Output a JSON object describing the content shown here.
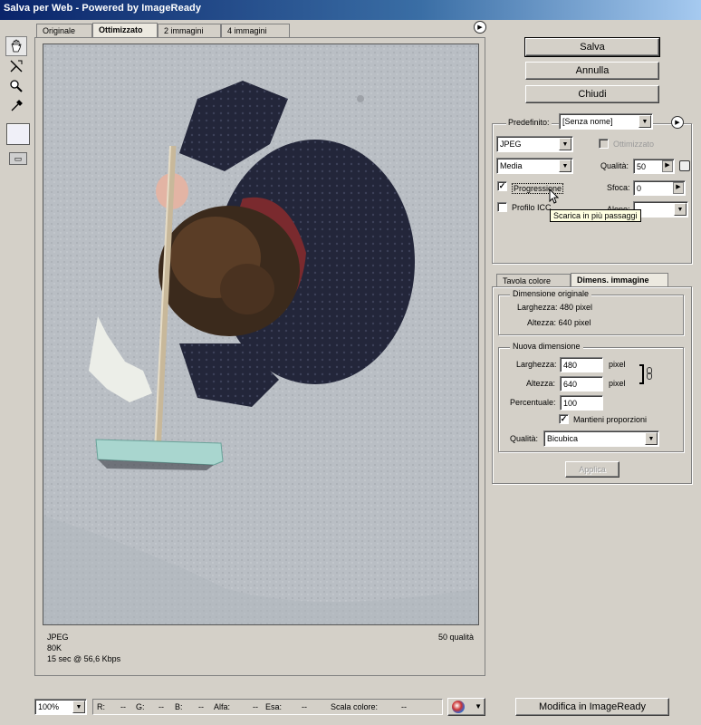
{
  "window": {
    "title": "Salva per Web - Powered by ImageReady"
  },
  "tabs": [
    "Originale",
    "Ottimizzato",
    "2 immagini",
    "4 immagini"
  ],
  "selected_tab": "Ottimizzato",
  "preview_info": {
    "format": "JPEG",
    "size": "80K",
    "time": "15 sec @ 56,6 Kbps",
    "quality": "50 qualità"
  },
  "buttons": {
    "save": "Salva",
    "cancel": "Annulla",
    "close": "Chiudi",
    "apply": "Applica",
    "edit_imageready": "Modifica in ImageReady"
  },
  "settings": {
    "preset_label": "Predefinito:",
    "preset_value": "[Senza nome]",
    "format": "JPEG",
    "quality_level": "Media",
    "optimized_label": "Ottimizzato",
    "optimized_checked": false,
    "quality_label": "Qualità:",
    "quality_value": "50",
    "progressive_label": "Progressione",
    "progressive_checked": true,
    "blur_label": "Sfoca:",
    "blur_value": "0",
    "icc_label": "Profilo ICC",
    "icc_checked": false,
    "matte_label": "Alone:",
    "tooltip": "Scarica in più passaggi"
  },
  "panel_tabs": [
    "Tavola colore",
    "Dimens. immagine"
  ],
  "selected_panel_tab": "Dimens. immagine",
  "original_size": {
    "legend": "Dimensione originale",
    "width": "Larghezza: 480 pixel",
    "height": "Altezza: 640 pixel"
  },
  "new_size": {
    "legend": "Nuova dimensione",
    "width_label": "Larghezza:",
    "width_value": "480",
    "height_label": "Altezza:",
    "height_value": "640",
    "unit": "pixel",
    "percent_label": "Percentuale:",
    "percent_value": "100",
    "constrain_label": "Mantieni proporzioni",
    "constrain_checked": true,
    "quality_label": "Qualità:",
    "quality_value": "Bicubica"
  },
  "statusbar": {
    "zoom": "100%",
    "r": "R:",
    "r_val": "--",
    "g": "G:",
    "g_val": "--",
    "b": "B:",
    "b_val": "--",
    "alpha": "Alfa:",
    "alpha_val": "--",
    "hex": "Esa:",
    "hex_val": "--",
    "index": "Scala colore:",
    "index_val": "--"
  },
  "icons": [
    "hand-icon",
    "slice-select-icon",
    "zoom-icon",
    "eyedropper-icon",
    "eyedropper-color-swatch",
    "slice-visibility-icon",
    "preview-menu-icon",
    "settings-menu-icon",
    "link-chain-icon",
    "browser-preview-icon"
  ]
}
